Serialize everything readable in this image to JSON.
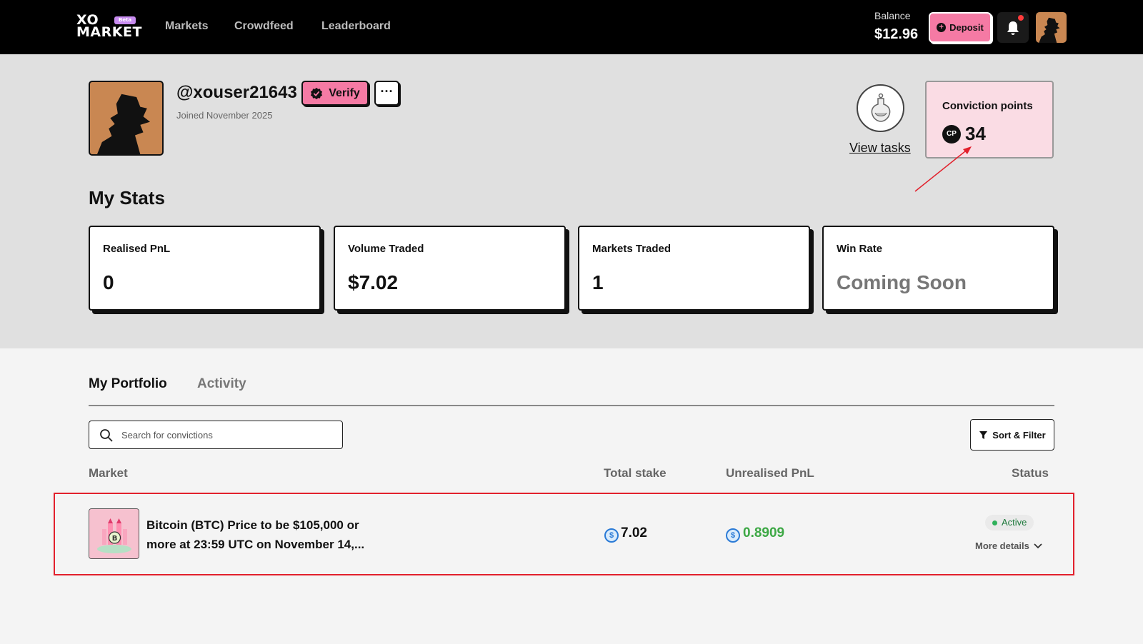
{
  "header": {
    "logo_line1": "XO",
    "logo_line2": "MARKET",
    "beta_badge": "Beta",
    "nav": [
      "Markets",
      "Crowdfeed",
      "Leaderboard"
    ],
    "balance_label": "Balance",
    "balance_value": "$12.96",
    "deposit_label": "Deposit",
    "notification_dot": true
  },
  "profile": {
    "username": "@xouser21643",
    "joined": "Joined November 2025",
    "verify_label": "Verify",
    "more_label": "···",
    "view_tasks_label": "View tasks",
    "conviction_title": "Conviction points",
    "conviction_badge": "CP",
    "conviction_value": "34"
  },
  "stats": {
    "title": "My Stats",
    "items": [
      {
        "label": "Realised PnL",
        "value": "0"
      },
      {
        "label": "Volume Traded",
        "value": "$7.02"
      },
      {
        "label": "Markets Traded",
        "value": "1"
      },
      {
        "label": "Win Rate",
        "value": "Coming Soon"
      }
    ]
  },
  "portfolio": {
    "tabs": [
      "My Portfolio",
      "Activity"
    ],
    "search_placeholder": "Search for convictions",
    "sort_filter_label": "Sort & Filter",
    "columns": [
      "Market",
      "Total stake",
      "Unrealised PnL",
      "Status"
    ],
    "rows": [
      {
        "market": "Bitcoin (BTC) Price to be $105,000 or more at 23:59 UTC on November 14,...",
        "total_stake": "7.02",
        "unrealised_pnl": "0.8909",
        "status": "Active",
        "more_details": "More details"
      }
    ]
  },
  "colors": {
    "accent_pink": "#f57aa4",
    "profit_green": "#3da845",
    "highlight_red": "#e2202c"
  }
}
